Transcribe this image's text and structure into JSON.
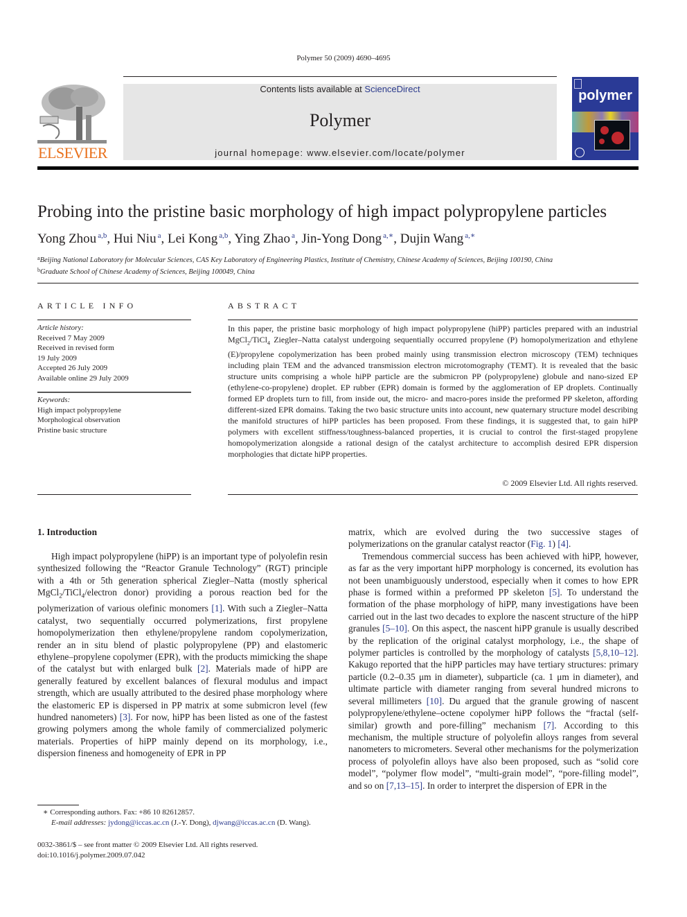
{
  "header": {
    "citation": "Polymer 50 (2009) 4690–4695",
    "contents_prefix": "Contents lists available at ",
    "contents_link": "ScienceDirect",
    "journal_name": "Polymer",
    "homepage": "journal homepage: www.elsevier.com/locate/polymer",
    "publisher_wordmark": "ELSEVIER",
    "cover_title": "polymer"
  },
  "colors": {
    "link": "#2b3a8c",
    "elsevier_orange": "#e9711c",
    "masthead_gray": "#e6e6e6",
    "cover_blue": "#2a3a96"
  },
  "article": {
    "title": "Probing into the pristine basic morphology of high impact polypropylene particles",
    "authors": [
      {
        "name": "Yong Zhou",
        "aff": "a,b"
      },
      {
        "name": "Hui Niu",
        "aff": "a"
      },
      {
        "name": "Lei Kong",
        "aff": "a,b"
      },
      {
        "name": "Ying Zhao",
        "aff": "a"
      },
      {
        "name": "Jin-Yong Dong",
        "aff": "a,∗"
      },
      {
        "name": "Dujin Wang",
        "aff": "a,∗"
      }
    ],
    "affiliations": [
      {
        "mark": "a",
        "text": "Beijing National Laboratory for Molecular Sciences, CAS Key Laboratory of Engineering Plastics, Institute of Chemistry, Chinese Academy of Sciences, Beijing 100190, China"
      },
      {
        "mark": "b",
        "text": "Graduate School of Chinese Academy of Sciences, Beijing 100049, China"
      }
    ]
  },
  "article_info": {
    "heading": "ARTICLE INFO",
    "history_label": "Article history:",
    "history": [
      "Received 7 May 2009",
      "Received in revised form",
      "19 July 2009",
      "Accepted 26 July 2009",
      "Available online 29 July 2009"
    ],
    "keywords_label": "Keywords:",
    "keywords": [
      "High impact polypropylene",
      "Morphological observation",
      "Pristine basic structure"
    ]
  },
  "abstract": {
    "heading": "ABSTRACT",
    "part1": "In this paper, the pristine basic morphology of high impact polypropylene (hiPP) particles prepared with an industrial MgCl",
    "sub1": "2",
    "part2": "/TiCl",
    "sub2": "4",
    "part3": " Ziegler–Natta catalyst undergoing sequentially occurred propylene (P) homopolymerization and ethylene (E)/propylene copolymerization has been probed mainly using transmission electron microscopy (TEM) techniques including plain TEM and the advanced transmission electron microtomography (TEMT). It is revealed that the basic structure units comprising a whole hiPP particle are the submicron PP (polypropylene) globule and nano-sized EP (ethylene-co-propylene) droplet. EP rubber (EPR) domain is formed by the agglomeration of EP droplets. Continually formed EP droplets turn to fill, from inside out, the micro- and macro-pores inside the preformed PP skeleton, affording different-sized EPR domains. Taking the two basic structure units into account, new quaternary structure model describing the manifold structures of hiPP particles has been proposed. From these findings, it is suggested that, to gain hiPP polymers with excellent stiffness/toughness-balanced properties, it is crucial to control the first-staged propylene homopolymerization alongside a rational design of the catalyst architecture to accomplish desired EPR dispersion morphologies that dictate hiPP properties.",
    "copyright": "© 2009 Elsevier Ltd. All rights reserved."
  },
  "body": {
    "section_heading": "1.  Introduction",
    "left": {
      "s1": "High impact polypropylene (hiPP) is an important type of polyolefin resin synthesized following the “Reactor Granule Technology” (RGT) principle with a 4th or 5th generation spherical Ziegler–Natta (mostly spherical MgCl",
      "sub1": "2",
      "s2": "/TiCl",
      "sub2": "4",
      "s3": "/electron donor) providing a porous reaction bed for the polymerization of various olefinic monomers ",
      "ref1": "[1]",
      "s4": ". With such a Ziegler–Natta catalyst, two sequentially occurred polymerizations, first propylene homopolymerization then ethylene/propylene random copolymerization, render an in situ blend of plastic polypropylene (PP) and elastomeric ethylene–propylene copolymer (EPR), with the products mimicking the shape of the catalyst but with enlarged bulk ",
      "ref2": "[2]",
      "s5": ". Materials made of hiPP are generally featured by excellent balances of flexural modulus and impact strength, which are usually attributed to the desired phase morphology where the elastomeric EP is dispersed in PP matrix at some submicron level (few hundred nanometers) ",
      "ref3": "[3]",
      "s6": ". For now, hiPP has been listed as one of the fastest growing polymers among the whole family of commercialized polymeric materials. Properties of hiPP mainly depend on its morphology, i.e., dispersion fineness and homogeneity of EPR in PP"
    },
    "right": {
      "p1a": "matrix, which are evolved during the two successive stages of polymerizations on the granular catalyst reactor (",
      "fig1": "Fig. 1",
      "p1b": ") ",
      "ref4": "[4]",
      "p1c": ".",
      "p2a": "Tremendous commercial success has been achieved with hiPP, however, as far as the very important hiPP morphology is concerned, its evolution has not been unambiguously understood, especially when it comes to how EPR phase is formed within a preformed PP skeleton ",
      "ref5": "[5]",
      "p2b": ". To understand the formation of the phase morphology of hiPP, many investigations have been carried out in the last two decades to explore the nascent structure of the hiPP granules ",
      "ref6": "[5–10]",
      "p2c": ". On this aspect, the nascent hiPP granule is usually described by the replication of the original catalyst morphology, i.e., the shape of polymer particles is controlled by the morphology of catalysts ",
      "ref7": "[5,8,10–12]",
      "p2d": ". Kakugo reported that the hiPP particles may have tertiary structures: primary particle (0.2–0.35 μm in diameter), subparticle (ca. 1 μm in diameter), and ultimate particle with diameter ranging from several hundred microns to several millimeters ",
      "ref8": "[10]",
      "p2e": ". Du argued that the granule growing of nascent polypropylene/ethylene–octene copolymer hiPP follows the “fractal (self-similar) growth and pore-filling” mechanism ",
      "ref9": "[7]",
      "p2f": ". According to this mechanism, the multiple structure of polyolefin alloys ranges from several nanometers to micrometers. Several other mechanisms for the polymerization process of polyolefin alloys have also been proposed, such as “solid core model”, “polymer flow model”, “multi-grain model”, “pore-filling model”, and so on ",
      "ref10": "[7,13–15]",
      "p2g": ". In order to interpret the dispersion of EPR in the"
    }
  },
  "footnote": {
    "star_line": "∗  Corresponding authors. Fax: +86 10 82612857.",
    "email_label": "E-mail addresses: ",
    "email1": "jydong@iccas.ac.cn",
    "email1_who": " (J.-Y. Dong), ",
    "email2": "djwang@iccas.ac.cn",
    "email2_who": " (D. Wang)."
  },
  "front_matter": {
    "issn_line": "0032-3861/$ – see front matter © 2009 Elsevier Ltd. All rights reserved.",
    "doi": "doi:10.1016/j.polymer.2009.07.042"
  }
}
